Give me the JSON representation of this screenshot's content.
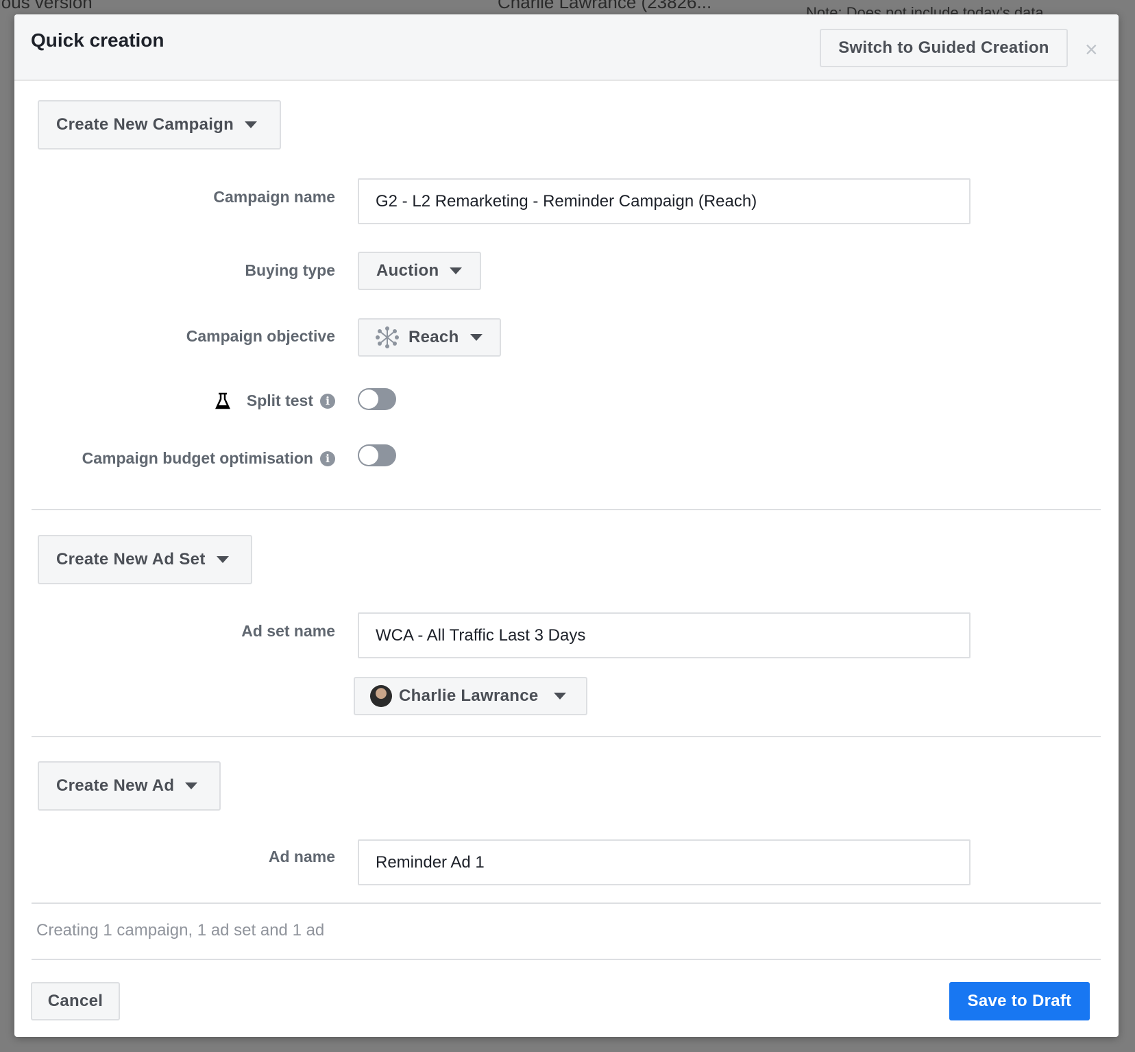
{
  "background": {
    "fragment_left": "ious version",
    "account": "Charlie Lawrance (23826...",
    "note": "Note: Does not include today's data"
  },
  "modal": {
    "title": "Quick creation",
    "switch_label": "Switch to Guided Creation",
    "close_icon": "×"
  },
  "campaign": {
    "create_label": "Create New Campaign",
    "name_label": "Campaign name",
    "name_value": "G2 - L2 Remarketing - Reminder Campaign (Reach)",
    "buying_type_label": "Buying type",
    "buying_type_value": "Auction",
    "objective_label": "Campaign objective",
    "objective_value": "Reach",
    "split_test_label": "Split test",
    "split_test_on": false,
    "cbo_label": "Campaign budget optimisation",
    "cbo_on": false
  },
  "ad_set": {
    "create_label": "Create New Ad Set",
    "name_label": "Ad set name",
    "name_value": "WCA - All Traffic Last 3 Days",
    "identity": "Charlie Lawrance"
  },
  "ad": {
    "create_label": "Create New Ad",
    "name_label": "Ad name",
    "name_value": "Reminder Ad 1"
  },
  "footer": {
    "summary": "Creating 1 campaign, 1 ad set and 1 ad",
    "cancel_label": "Cancel",
    "save_label": "Save to Draft",
    "accent": "#1877f2"
  }
}
